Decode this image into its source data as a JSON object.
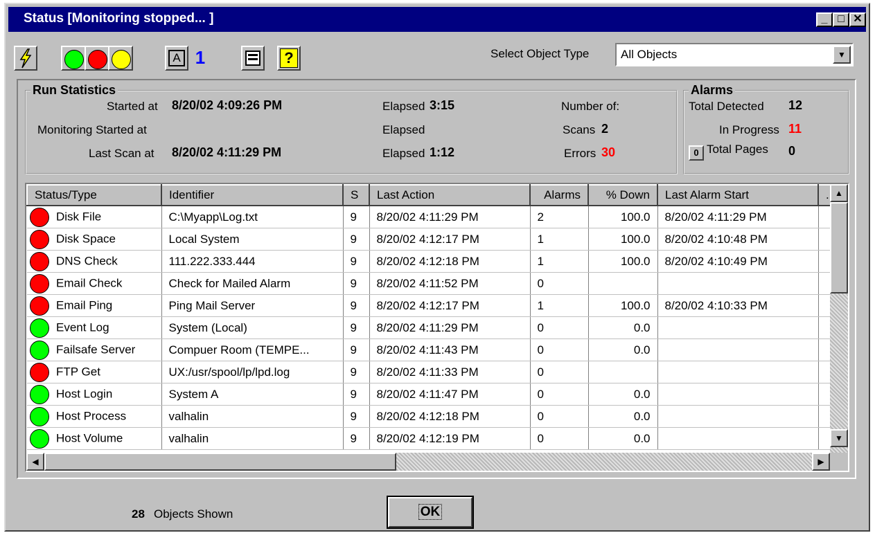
{
  "window": {
    "title": "Status [Monitoring stopped... ]"
  },
  "titlebar_buttons": {
    "minimize": "_",
    "maximize": "□",
    "close": "✕"
  },
  "toolbar": {
    "select_label": "Select Object Type",
    "select_value": "All Objects",
    "a_label": "A",
    "one_label": "1",
    "help_label": "?"
  },
  "run_stats": {
    "title": "Run Statistics",
    "started_label": "Started at",
    "started_value": "8/20/02 4:09:26 PM",
    "monitoring_label": "Monitoring Started at",
    "last_scan_label": "Last Scan at",
    "last_scan_value": "8/20/02 4:11:29 PM",
    "elapsed1_label": "Elapsed",
    "elapsed1_value": "3:15",
    "elapsed2_label": "Elapsed",
    "elapsed3_label": "Elapsed",
    "elapsed3_value": "1:12",
    "number_of_label": "Number of:",
    "scans_label": "Scans",
    "scans_value": "2",
    "errors_label": "Errors",
    "errors_value": "30"
  },
  "alarms": {
    "title": "Alarms",
    "total_detected_label": "Total Detected",
    "total_detected_value": "12",
    "in_progress_label": "In Progress",
    "in_progress_value": "11",
    "pages_button": "0",
    "total_pages_label": "Total Pages",
    "total_pages_value": "0"
  },
  "table": {
    "columns": [
      "Status/Type",
      "Identifier",
      "S",
      "Last Action",
      "Alarms",
      "% Down",
      "Last Alarm Start",
      "."
    ],
    "rows": [
      {
        "status": "red",
        "type": "Disk File",
        "identifier": "C:\\Myapp\\Log.txt",
        "s": "9",
        "last_action": "8/20/02 4:11:29 PM",
        "alarms": "2",
        "down": "100.0",
        "last_alarm": "8/20/02 4:11:29 PM"
      },
      {
        "status": "red",
        "type": "Disk Space",
        "identifier": "Local System",
        "s": "9",
        "last_action": "8/20/02 4:12:17 PM",
        "alarms": "1",
        "down": "100.0",
        "last_alarm": "8/20/02 4:10:48 PM"
      },
      {
        "status": "red",
        "type": "DNS Check",
        "identifier": "111.222.333.444",
        "s": "9",
        "last_action": "8/20/02 4:12:18 PM",
        "alarms": "1",
        "down": "100.0",
        "last_alarm": "8/20/02 4:10:49 PM"
      },
      {
        "status": "red",
        "type": "Email Check",
        "identifier": "Check for Mailed Alarm",
        "s": "9",
        "last_action": "8/20/02 4:11:52 PM",
        "alarms": "0",
        "down": "",
        "last_alarm": ""
      },
      {
        "status": "red",
        "type": "Email Ping",
        "identifier": "Ping Mail Server",
        "s": "9",
        "last_action": "8/20/02 4:12:17 PM",
        "alarms": "1",
        "down": "100.0",
        "last_alarm": "8/20/02 4:10:33 PM"
      },
      {
        "status": "green",
        "type": "Event Log",
        "identifier": "System (Local)",
        "s": "9",
        "last_action": "8/20/02 4:11:29 PM",
        "alarms": "0",
        "down": "0.0",
        "last_alarm": ""
      },
      {
        "status": "green",
        "type": "Failsafe Server",
        "identifier": "Compuer Room (TEMPE...",
        "s": "9",
        "last_action": "8/20/02 4:11:43 PM",
        "alarms": "0",
        "down": "0.0",
        "last_alarm": ""
      },
      {
        "status": "red",
        "type": "FTP Get",
        "identifier": "UX:/usr/spool/lp/lpd.log",
        "s": "9",
        "last_action": "8/20/02 4:11:33 PM",
        "alarms": "0",
        "down": "",
        "last_alarm": ""
      },
      {
        "status": "green",
        "type": "Host Login",
        "identifier": "System A",
        "s": "9",
        "last_action": "8/20/02 4:11:47 PM",
        "alarms": "0",
        "down": "0.0",
        "last_alarm": ""
      },
      {
        "status": "green",
        "type": "Host Process",
        "identifier": "valhalin",
        "s": "9",
        "last_action": "8/20/02 4:12:18 PM",
        "alarms": "0",
        "down": "0.0",
        "last_alarm": ""
      },
      {
        "status": "green",
        "type": "Host Volume",
        "identifier": "valhalin",
        "s": "9",
        "last_action": "8/20/02 4:12:19 PM",
        "alarms": "0",
        "down": "0.0",
        "last_alarm": ""
      }
    ]
  },
  "footer": {
    "count": "28",
    "count_label": "Objects Shown",
    "ok_label": "OK"
  },
  "colors": {
    "red": "#ff0000",
    "green": "#00ff00",
    "yellow": "#ffff00",
    "title_bg": "#000080"
  }
}
